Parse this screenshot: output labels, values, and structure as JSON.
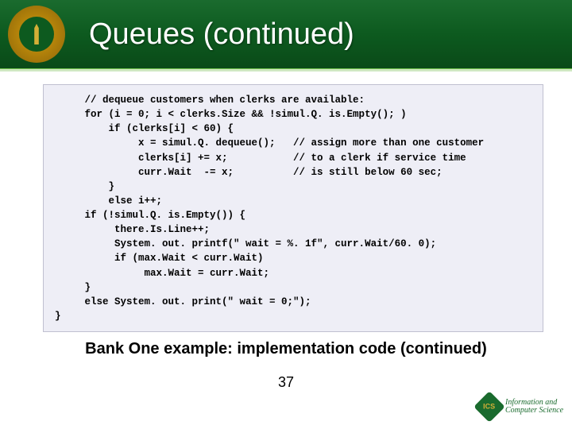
{
  "header": {
    "title": "Queues (continued)"
  },
  "code": {
    "lines": [
      "     // dequeue customers when clerks are available:",
      "     for (i = 0; i < clerks.Size && !simul.Q. is.Empty(); )",
      "         if (clerks[i] < 60) {",
      "              x = simul.Q. dequeue();   // assign more than one customer",
      "              clerks[i] += x;           // to a clerk if service time",
      "              curr.Wait  -= x;          // is still below 60 sec;",
      "         }",
      "         else i++;",
      "     if (!simul.Q. is.Empty()) {",
      "          there.Is.Line++;",
      "          System. out. printf(\" wait = %. 1f\", curr.Wait/60. 0);",
      "          if (max.Wait < curr.Wait)",
      "               max.Wait = curr.Wait;",
      "     }",
      "     else System. out. print(\" wait = 0;\");",
      "}"
    ]
  },
  "caption": "Bank One example: implementation code (continued)",
  "page_number": "37",
  "footer": {
    "badge": "ICS",
    "line1": "Information and",
    "line2": "Computer Science"
  }
}
